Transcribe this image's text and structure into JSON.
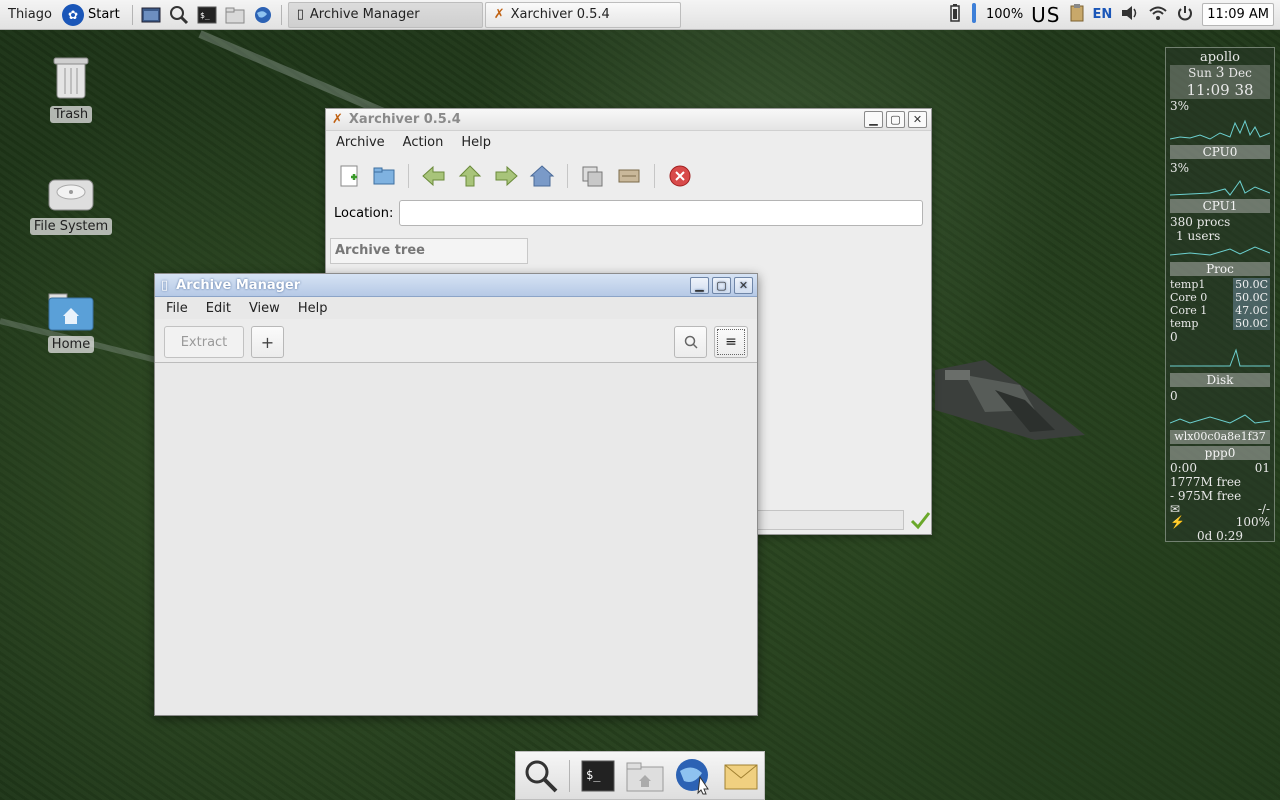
{
  "top_panel": {
    "user": "Thiago",
    "start_label": "Start",
    "tasks": [
      {
        "label": "Archive Manager",
        "active": true
      },
      {
        "label": "Xarchiver 0.5.4",
        "active": false
      }
    ],
    "battery_percent": "100%",
    "keyboard_layout": "US",
    "language": "EN",
    "clock": "11:09 AM"
  },
  "desktop_icons": [
    {
      "label": "Trash"
    },
    {
      "label": "File System"
    },
    {
      "label": "Home"
    }
  ],
  "xarchiver": {
    "title": "Xarchiver 0.5.4",
    "menu": [
      "Archive",
      "Action",
      "Help"
    ],
    "location_label": "Location:",
    "location_value": "",
    "archive_tree_header": "Archive tree"
  },
  "archive_manager": {
    "title": "Archive Manager",
    "menu": [
      "File",
      "Edit",
      "View",
      "Help"
    ],
    "extract_label": "Extract",
    "add_label": "+",
    "menu_button_label": "≡"
  },
  "conky": {
    "hostname": "apollo",
    "date_day": "Sun",
    "date_num": "3",
    "date_month": "Dec",
    "time": "11:09 38",
    "cpu0_pct": "3%",
    "cpu0_label": "CPU0",
    "cpu1_pct": "3%",
    "cpu1_label": "CPU1",
    "procs": "380 procs",
    "users": "1 users",
    "proc_label": "Proc",
    "temps": [
      {
        "name": "temp1",
        "value": "50.0C"
      },
      {
        "name": "Core 0",
        "value": "50.0C"
      },
      {
        "name": "Core 1",
        "value": "47.0C"
      },
      {
        "name": "temp",
        "value": "50.0C"
      }
    ],
    "proc_graph_val": "0",
    "disk_label": "Disk",
    "disk_val": "0",
    "net_iface_id": "wlx00c0a8e1f37",
    "net_label": "ppp0",
    "net_time": "0:00",
    "net_time_suffix": "01",
    "mem_free": "1777M free",
    "swap_free": "- 975M free",
    "mail": "-/-",
    "battery": "100%",
    "uptime": "0d  0:29"
  },
  "colors": {
    "am_title": "#b6c9e6",
    "panel_bg": "#ececec",
    "desktop_green": "#26401e"
  },
  "dock_icons": [
    "search-icon",
    "terminal-icon",
    "home-folder-icon",
    "web-browser-icon",
    "mail-icon"
  ]
}
